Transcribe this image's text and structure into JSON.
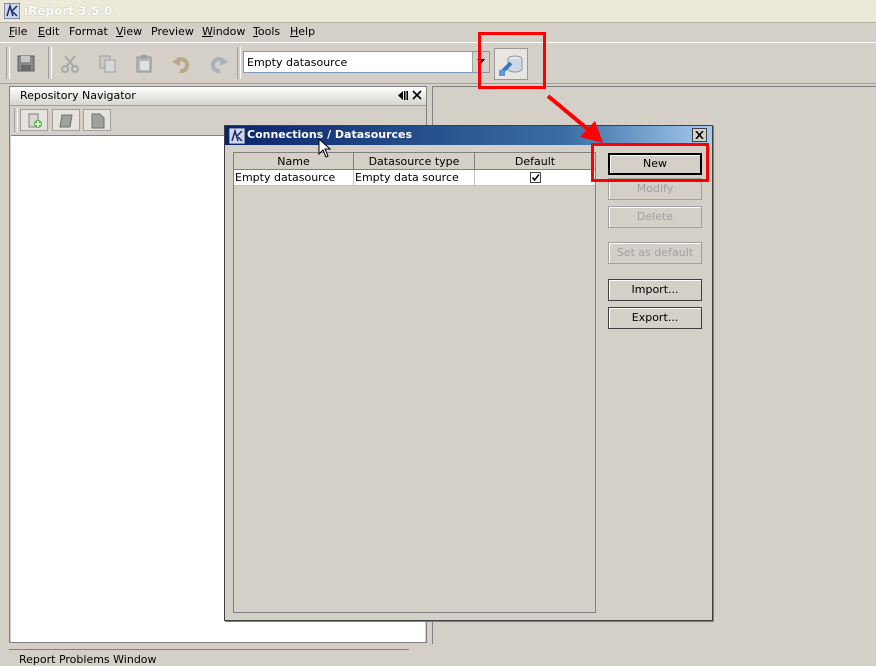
{
  "window": {
    "title": "iReport 3.5.0"
  },
  "menu": {
    "items": [
      {
        "label": "File",
        "mnemonic": "F",
        "rest": "ile"
      },
      {
        "label": "Edit",
        "mnemonic": "E",
        "rest": "dit"
      },
      {
        "label": "Format",
        "mnemonic": "",
        "rest": "Format"
      },
      {
        "label": "View",
        "mnemonic": "V",
        "rest": "iew"
      },
      {
        "label": "Preview",
        "mnemonic": "",
        "rest": "Preview"
      },
      {
        "label": "Window",
        "mnemonic": "W",
        "rest": "indow"
      },
      {
        "label": "Tools",
        "mnemonic": "T",
        "rest": "ools"
      },
      {
        "label": "Help",
        "mnemonic": "H",
        "rest": "elp"
      }
    ]
  },
  "toolbar": {
    "datasource_selected": "Empty datasource",
    "icons": [
      "save-icon",
      "cut-icon",
      "copy-icon",
      "paste-icon",
      "undo-icon",
      "redo-icon",
      "connections-icon"
    ]
  },
  "repository": {
    "title": "Repository Navigator",
    "icons": [
      "add-server-icon",
      "folder-icon",
      "document-icon"
    ]
  },
  "bottom": {
    "problems_title": "Report Problems Window"
  },
  "dialog": {
    "title": "Connections / Datasources",
    "columns": [
      "Name",
      "Datasource type",
      "Default"
    ],
    "rows": [
      {
        "name": "Empty datasource",
        "type": "Empty data source",
        "default": true
      }
    ],
    "buttons": {
      "new": "New",
      "modify": "Modify",
      "delete": "Delete",
      "set_default": "Set as default",
      "import": "Import...",
      "export": "Export..."
    }
  },
  "colors": {
    "highlight": "#ff0000",
    "dialog_title_start": "#0a246a",
    "dialog_title_end": "#a6caf0",
    "panel_bg": "#d4d0c8"
  }
}
